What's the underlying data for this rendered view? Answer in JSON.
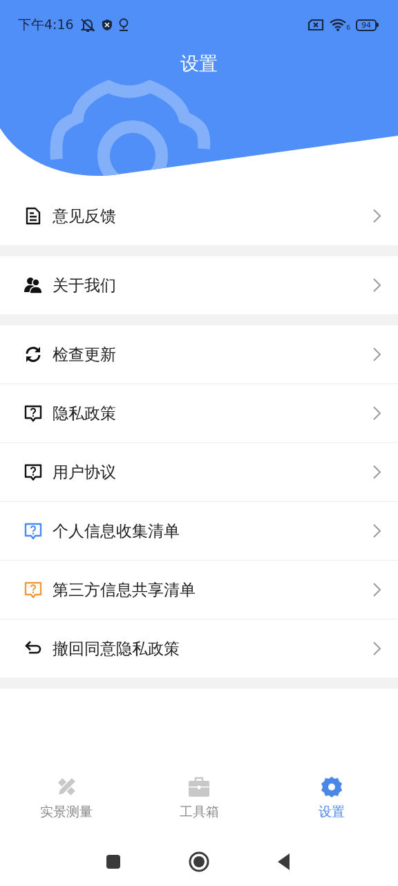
{
  "status_bar": {
    "time": "下午4:16",
    "wifi_label": "6",
    "battery": "94"
  },
  "header": {
    "title": "设置"
  },
  "groups": [
    {
      "items": [
        {
          "label": "意见反馈",
          "kind": "document"
        }
      ]
    },
    {
      "items": [
        {
          "label": "关于我们",
          "kind": "people"
        }
      ]
    },
    {
      "items": [
        {
          "label": "检查更新",
          "kind": "refresh"
        },
        {
          "label": "隐私政策",
          "kind": "question",
          "color": "#111111"
        },
        {
          "label": "用户协议",
          "kind": "question",
          "color": "#111111"
        },
        {
          "label": "个人信息收集清单",
          "kind": "question",
          "color": "#4a8af4"
        },
        {
          "label": "第三方信息共享清单",
          "kind": "question",
          "color": "#ef9a3c"
        },
        {
          "label": "撤回同意隐私政策",
          "kind": "undo"
        }
      ]
    }
  ],
  "tabs": [
    {
      "label": "实景测量",
      "kind": "measure",
      "selected": false
    },
    {
      "label": "工具箱",
      "kind": "toolbox",
      "selected": false
    },
    {
      "label": "设置",
      "kind": "gear",
      "selected": true
    }
  ]
}
